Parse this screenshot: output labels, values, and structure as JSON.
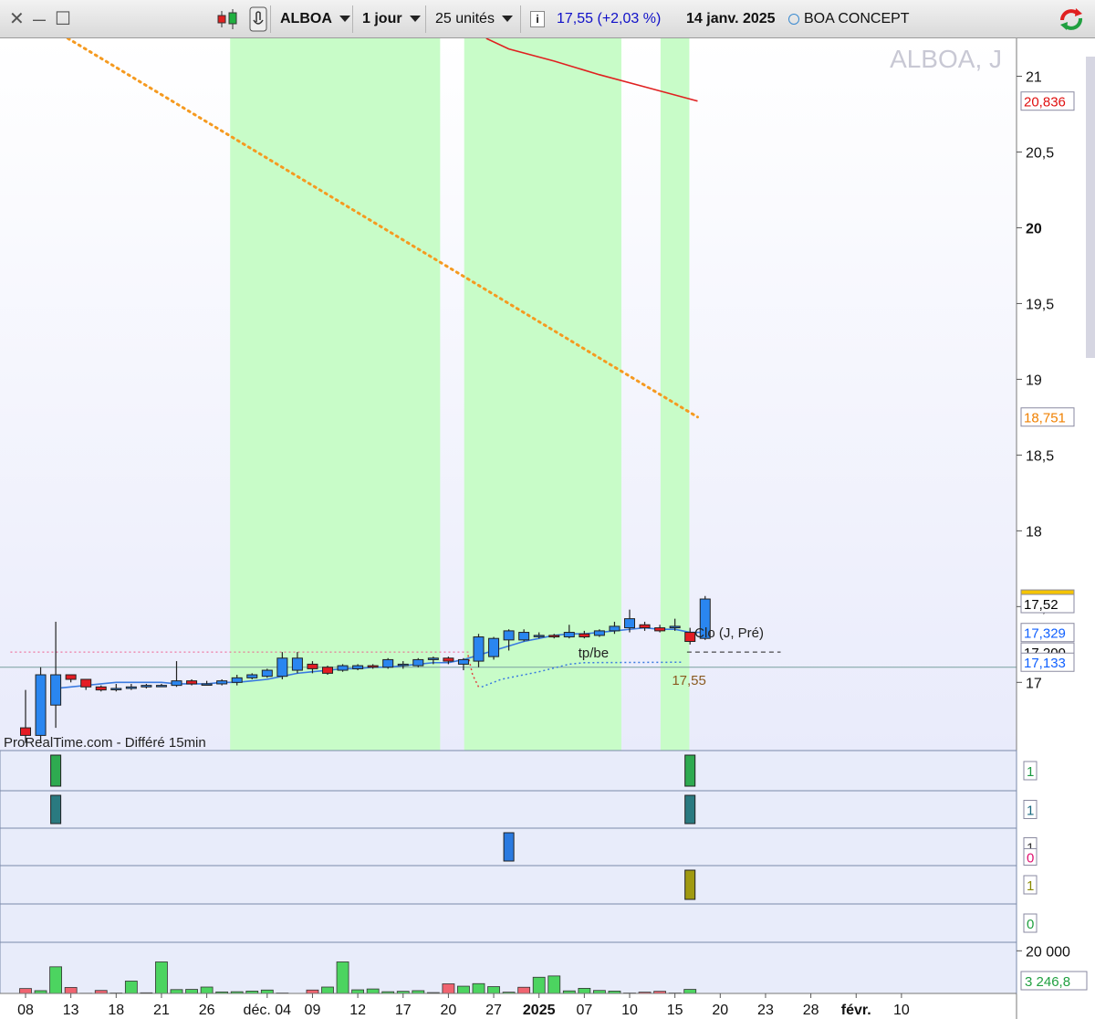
{
  "toolbar": {
    "close_glyph": "✕",
    "min_glyph": "—",
    "max_glyph": "☐",
    "ticker": "ALBOA",
    "interval": "1 jour",
    "units": "25 unités",
    "info_glyph": "i",
    "quote": "17,55  (+2,03  %)",
    "date": "14 janv. 2025",
    "company": "BOA CONCEPT",
    "icons": [
      "candlestick-icon",
      "hand-cursor-icon",
      "info-icon",
      "refresh-icon"
    ]
  },
  "chart_data": {
    "type": "candlestick",
    "title": "ALBOA, J",
    "watermark": "ProRealTime.com - Différé 15min",
    "annotations": {
      "tp_be": "tp/be",
      "clo": "Clo (J, Pré)",
      "price_label": "17,55"
    },
    "y_axis": {
      "ticks": [
        "17",
        "17,5",
        "18",
        "18,5",
        "19",
        "19,5",
        "20",
        "20,5",
        "21"
      ],
      "bold_tick": "20",
      "ylim": [
        16.55,
        21.25
      ]
    },
    "x_axis": {
      "ticks": [
        {
          "label": "08",
          "i": 0
        },
        {
          "label": "13",
          "i": 3
        },
        {
          "label": "18",
          "i": 6
        },
        {
          "label": "21",
          "i": 9
        },
        {
          "label": "26",
          "i": 12
        },
        {
          "label": "déc. 04",
          "i": 16
        },
        {
          "label": "09",
          "i": 19
        },
        {
          "label": "12",
          "i": 22
        },
        {
          "label": "17",
          "i": 25
        },
        {
          "label": "20",
          "i": 28
        },
        {
          "label": "27",
          "i": 31
        },
        {
          "label": "2025",
          "i": 34,
          "bold": true
        },
        {
          "label": "07",
          "i": 37
        },
        {
          "label": "10",
          "i": 40
        },
        {
          "label": "15",
          "i": 43
        },
        {
          "label": "20",
          "i": 46
        },
        {
          "label": "23",
          "i": 49
        },
        {
          "label": "28",
          "i": 52
        },
        {
          "label": "févr.",
          "i": 55,
          "bold": true
        },
        {
          "label": "10",
          "i": 58
        }
      ]
    },
    "price_labels": [
      {
        "text": "20,836",
        "value": 20.836,
        "color": "#e01010",
        "bg": "#ffffff"
      },
      {
        "text": "18,751",
        "value": 18.751,
        "color": "#f08000",
        "bg": "#ffffff"
      },
      {
        "text": "17,55",
        "value": 17.55,
        "color": "#000000",
        "bg": "#f5c400"
      },
      {
        "text": "17,52",
        "value": 17.52,
        "color": "#000000",
        "bg": "#ffffff"
      },
      {
        "text": "17,329",
        "value": 17.329,
        "color": "#1060ff",
        "bg": "#ffffff"
      },
      {
        "text": "17,200",
        "value": 17.2,
        "color": "#000000",
        "bg": "#ffffff"
      },
      {
        "text": "17,133",
        "value": 17.133,
        "color": "#1060ff",
        "bg": "#ffffff"
      }
    ],
    "highlight_zones": [
      [
        14,
        27
      ],
      [
        29.5,
        39
      ],
      [
        42.5,
        43.5
      ]
    ],
    "candles": [
      {
        "o": 16.7,
        "h": 16.95,
        "l": 16.6,
        "c": 16.65
      },
      {
        "o": 16.65,
        "h": 17.1,
        "l": 16.6,
        "c": 17.05
      },
      {
        "o": 16.85,
        "h": 17.4,
        "l": 16.7,
        "c": 17.05
      },
      {
        "o": 17.05,
        "h": 17.05,
        "l": 17.0,
        "c": 17.02
      },
      {
        "o": 17.02,
        "h": 17.02,
        "l": 16.95,
        "c": 16.97
      },
      {
        "o": 16.97,
        "h": 16.98,
        "l": 16.94,
        "c": 16.95
      },
      {
        "o": 16.96,
        "h": 16.99,
        "l": 16.94,
        "c": 16.96
      },
      {
        "o": 16.96,
        "h": 16.99,
        "l": 16.95,
        "c": 16.97
      },
      {
        "o": 16.97,
        "h": 16.99,
        "l": 16.96,
        "c": 16.98
      },
      {
        "o": 16.98,
        "h": 16.99,
        "l": 16.97,
        "c": 16.98
      },
      {
        "o": 16.98,
        "h": 17.14,
        "l": 16.97,
        "c": 17.01
      },
      {
        "o": 17.01,
        "h": 17.02,
        "l": 16.98,
        "c": 16.99
      },
      {
        "o": 16.99,
        "h": 17.01,
        "l": 16.98,
        "c": 16.99
      },
      {
        "o": 16.99,
        "h": 17.02,
        "l": 16.98,
        "c": 17.01
      },
      {
        "o": 17.0,
        "h": 17.05,
        "l": 16.98,
        "c": 17.03
      },
      {
        "o": 17.03,
        "h": 17.06,
        "l": 17.02,
        "c": 17.05
      },
      {
        "o": 17.04,
        "h": 17.09,
        "l": 17.03,
        "c": 17.08
      },
      {
        "o": 17.04,
        "h": 17.2,
        "l": 17.02,
        "c": 17.16
      },
      {
        "o": 17.08,
        "h": 17.2,
        "l": 17.06,
        "c": 17.16
      },
      {
        "o": 17.12,
        "h": 17.14,
        "l": 17.06,
        "c": 17.09
      },
      {
        "o": 17.1,
        "h": 17.11,
        "l": 17.05,
        "c": 17.06
      },
      {
        "o": 17.08,
        "h": 17.12,
        "l": 17.07,
        "c": 17.11
      },
      {
        "o": 17.09,
        "h": 17.12,
        "l": 17.08,
        "c": 17.11
      },
      {
        "o": 17.11,
        "h": 17.12,
        "l": 17.09,
        "c": 17.1
      },
      {
        "o": 17.1,
        "h": 17.16,
        "l": 17.09,
        "c": 17.15
      },
      {
        "o": 17.12,
        "h": 17.14,
        "l": 17.09,
        "c": 17.12
      },
      {
        "o": 17.11,
        "h": 17.16,
        "l": 17.1,
        "c": 17.15
      },
      {
        "o": 17.15,
        "h": 17.17,
        "l": 17.12,
        "c": 17.16
      },
      {
        "o": 17.16,
        "h": 17.17,
        "l": 17.12,
        "c": 17.14
      },
      {
        "o": 17.12,
        "h": 17.16,
        "l": 17.08,
        "c": 17.15
      },
      {
        "o": 17.14,
        "h": 17.32,
        "l": 17.1,
        "c": 17.3
      },
      {
        "o": 17.17,
        "h": 17.3,
        "l": 17.15,
        "c": 17.29
      },
      {
        "o": 17.28,
        "h": 17.35,
        "l": 17.21,
        "c": 17.34
      },
      {
        "o": 17.28,
        "h": 17.35,
        "l": 17.27,
        "c": 17.33
      },
      {
        "o": 17.31,
        "h": 17.33,
        "l": 17.29,
        "c": 17.31
      },
      {
        "o": 17.31,
        "h": 17.32,
        "l": 17.29,
        "c": 17.3
      },
      {
        "o": 17.3,
        "h": 17.38,
        "l": 17.29,
        "c": 17.33
      },
      {
        "o": 17.32,
        "h": 17.34,
        "l": 17.29,
        "c": 17.3
      },
      {
        "o": 17.31,
        "h": 17.35,
        "l": 17.3,
        "c": 17.34
      },
      {
        "o": 17.34,
        "h": 17.4,
        "l": 17.32,
        "c": 17.37
      },
      {
        "o": 17.36,
        "h": 17.48,
        "l": 17.33,
        "c": 17.42
      },
      {
        "o": 17.38,
        "h": 17.4,
        "l": 17.34,
        "c": 17.36
      },
      {
        "o": 17.36,
        "h": 17.38,
        "l": 17.33,
        "c": 17.34
      },
      {
        "o": 17.36,
        "h": 17.42,
        "l": 17.34,
        "c": 17.37
      },
      {
        "o": 17.33,
        "h": 17.36,
        "l": 17.25,
        "c": 17.27
      },
      {
        "o": 17.29,
        "h": 17.57,
        "l": 17.28,
        "c": 17.55
      }
    ],
    "ma_blue": {
      "from": 2,
      "values": [
        16.96,
        16.97,
        16.98,
        16.99,
        17.0,
        17.0,
        17.0,
        17.0,
        16.99,
        16.99,
        16.99,
        17.0,
        17.0,
        17.01,
        17.02,
        17.04,
        17.06,
        17.07,
        17.08,
        17.09,
        17.09,
        17.1,
        17.1,
        17.11,
        17.12,
        17.13,
        17.13,
        17.15,
        17.18,
        17.21,
        17.24,
        17.27,
        17.29,
        17.31,
        17.32,
        17.32,
        17.33,
        17.34,
        17.35,
        17.36,
        17.35,
        17.35,
        17.33,
        17.33
      ]
    },
    "trend_orange": {
      "from_i": 2.8,
      "from_v": 21.25,
      "to_i": 44.5,
      "to_v": 18.751
    },
    "trend_red": {
      "points": [
        [
          30.5,
          21.25
        ],
        [
          32,
          21.18
        ],
        [
          35,
          21.1
        ],
        [
          38,
          21.01
        ],
        [
          41,
          20.93
        ],
        [
          44.5,
          20.836
        ]
      ]
    },
    "dotted_pink": {
      "from_i": -1,
      "to_i": 29.4,
      "value": 17.2
    },
    "dashed_black": {
      "from_i": 43.8,
      "to_i": 50,
      "value": 17.2
    },
    "dotted_blue_lower": {
      "points": [
        [
          30.2,
          16.97
        ],
        [
          31.5,
          17.02
        ],
        [
          34,
          17.07
        ],
        [
          36,
          17.12
        ],
        [
          37,
          17.13
        ],
        [
          43.5,
          17.133
        ]
      ]
    },
    "dotted_red_lower": {
      "points": [
        [
          29.3,
          17.18
        ],
        [
          29.6,
          17.05
        ],
        [
          30,
          16.97
        ]
      ]
    },
    "indicators": [
      {
        "label": "1",
        "label_color": "#1a9a40",
        "bars": [
          {
            "i": 2,
            "color": "#2eaa50"
          },
          {
            "i": 44,
            "color": "#2eaa50"
          }
        ]
      },
      {
        "label": "1",
        "label_color": "#1a6a80",
        "bars": [
          {
            "i": 2,
            "color": "#2a7a80"
          },
          {
            "i": 44,
            "color": "#2a7a80"
          }
        ]
      },
      {
        "label": "1",
        "label_color": "#333333",
        "extra": "0",
        "extra_color": "#e01070",
        "bars": [
          {
            "i": 32,
            "color": "#2a7ae0"
          }
        ]
      },
      {
        "label": "1",
        "label_color": "#8a8a00",
        "bars": [
          {
            "i": 44,
            "color": "#a09a10"
          }
        ]
      },
      {
        "label": "0",
        "label_color": "#20a040",
        "bars": []
      }
    ],
    "volume": {
      "y_label": "20  000",
      "last_label": "3  246,8",
      "max": 24000,
      "values": [
        2300,
        1300,
        12500,
        2800,
        100,
        1400,
        200,
        5800,
        300,
        14800,
        1800,
        1900,
        3000,
        700,
        800,
        1100,
        1600,
        200,
        0,
        1600,
        3000,
        14800,
        1700,
        2100,
        800,
        1000,
        1300,
        400,
        4500,
        3400,
        4600,
        3200,
        600,
        2900,
        7600,
        8200,
        1200,
        2400,
        1400,
        1100,
        200,
        600,
        1000,
        200,
        1900
      ],
      "up": [
        false,
        true,
        true,
        false,
        false,
        false,
        false,
        true,
        false,
        true,
        true,
        true,
        true,
        true,
        true,
        true,
        true,
        true,
        false,
        false,
        true,
        true,
        true,
        true,
        true,
        true,
        true,
        true,
        false,
        true,
        true,
        true,
        true,
        false,
        true,
        true,
        true,
        true,
        true,
        true,
        true,
        false,
        false,
        true,
        true
      ]
    }
  }
}
